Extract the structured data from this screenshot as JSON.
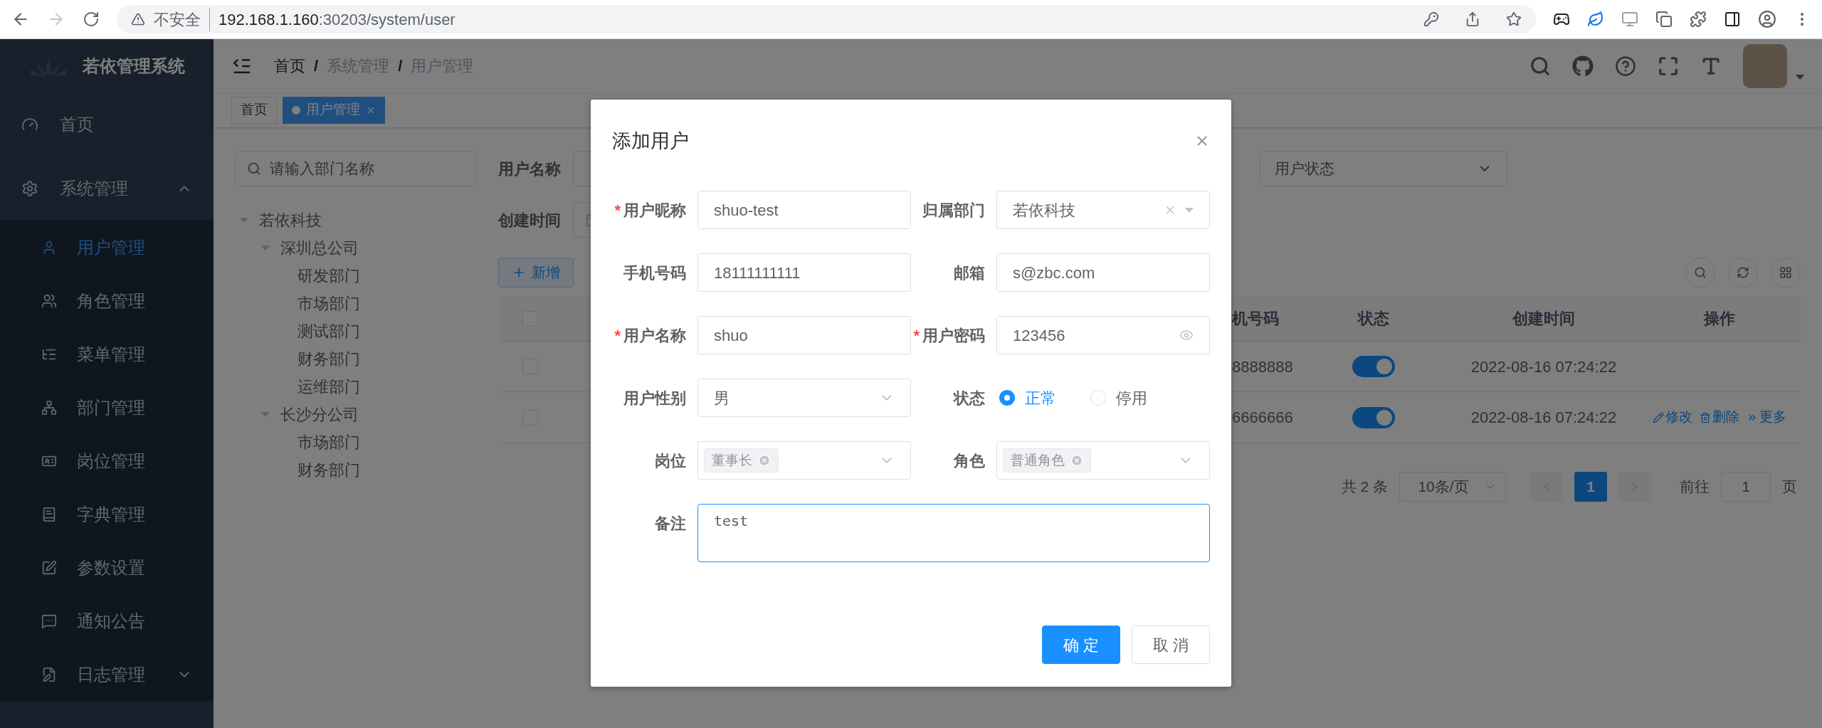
{
  "browser": {
    "security_label": "不安全",
    "url_host": "192.168.1.160",
    "url_rest": ":30203/system/user"
  },
  "sidebar": {
    "title": "若依管理系统",
    "items": [
      {
        "label": "首页"
      },
      {
        "label": "系统管理",
        "expanded": true,
        "children": [
          {
            "label": "用户管理",
            "selected": true
          },
          {
            "label": "角色管理",
            "selected": false
          },
          {
            "label": "菜单管理",
            "selected": false
          },
          {
            "label": "部门管理",
            "selected": false
          },
          {
            "label": "岗位管理",
            "selected": false
          },
          {
            "label": "字典管理",
            "selected": false
          },
          {
            "label": "参数设置",
            "selected": false
          },
          {
            "label": "通知公告",
            "selected": false
          },
          {
            "label": "日志管理",
            "selected": false,
            "expanded": false
          }
        ]
      }
    ]
  },
  "breadcrumb": {
    "separator": "/",
    "items": [
      "首页",
      "系统管理",
      "用户管理"
    ]
  },
  "tags": [
    {
      "label": "首页",
      "selected": false
    },
    {
      "label": "用户管理",
      "selected": true
    }
  ],
  "dept_tree": {
    "placeholder": "请输入部门名称",
    "nodes": [
      {
        "label": "若依科技",
        "expanded": true,
        "children": [
          {
            "label": "深圳总公司",
            "expanded": true,
            "children": [
              {
                "label": "研发部门"
              },
              {
                "label": "市场部门"
              },
              {
                "label": "测试部门"
              },
              {
                "label": "财务部门"
              },
              {
                "label": "运维部门"
              }
            ]
          },
          {
            "label": "长沙分公司",
            "expanded": true,
            "children": [
              {
                "label": "市场部门"
              },
              {
                "label": "财务部门"
              }
            ]
          }
        ]
      }
    ]
  },
  "search_form": {
    "name_label": "用户名称",
    "status_placeholder": "用户状态",
    "time_label": "创建时间"
  },
  "add_button": "新增",
  "table": {
    "header_checked": false,
    "columns": [
      "机号码",
      "状态",
      "创建时间",
      "操作"
    ],
    "rows": [
      {
        "checked": false,
        "phone": "8888888",
        "on": true,
        "created": "2022-08-16 07:24:22"
      },
      {
        "checked": false,
        "phone": "6666666",
        "on": true,
        "created": "2022-08-16 07:24:22",
        "actions": [
          "修改",
          "删除",
          "更多"
        ]
      }
    ]
  },
  "pagination": {
    "total": "共 2 条",
    "page_size": "10条/页",
    "pages": [
      {
        "label": "1",
        "selected": true
      }
    ],
    "goto_label": "前往",
    "goto_value": "1",
    "page_suffix": "页"
  },
  "dialog": {
    "title": "添加用户",
    "required_mark": "*",
    "fields": [
      {
        "kind": "input",
        "label": "用户昵称",
        "required": true,
        "value": "shuo-test"
      },
      {
        "kind": "tree_select",
        "label": "归属部门",
        "required": false,
        "value": "若依科技"
      },
      {
        "kind": "input",
        "label": "手机号码",
        "required": false,
        "value": "18111111111"
      },
      {
        "kind": "input",
        "label": "邮箱",
        "required": false,
        "value": "s@zbc.com"
      },
      {
        "kind": "input",
        "label": "用户名称",
        "required": true,
        "value": "shuo"
      },
      {
        "kind": "password",
        "label": "用户密码",
        "required": true,
        "value": "123456"
      },
      {
        "kind": "select",
        "label": "用户性别",
        "required": false,
        "value": "男"
      },
      {
        "kind": "radio",
        "label": "状态",
        "required": false,
        "options": [
          {
            "label": "正常",
            "selected": true
          },
          {
            "label": "停用",
            "selected": false
          }
        ]
      },
      {
        "kind": "tags",
        "label": "岗位",
        "required": false,
        "tags": [
          "董事长"
        ]
      },
      {
        "kind": "tags",
        "label": "角色",
        "required": false,
        "tags": [
          "普通角色"
        ]
      },
      {
        "kind": "textarea",
        "label": "备注",
        "required": false,
        "value": "test",
        "focused": true
      }
    ],
    "buttons": [
      {
        "label": "确定",
        "kind": "primary"
      },
      {
        "label": "取消",
        "kind": "default"
      }
    ]
  }
}
